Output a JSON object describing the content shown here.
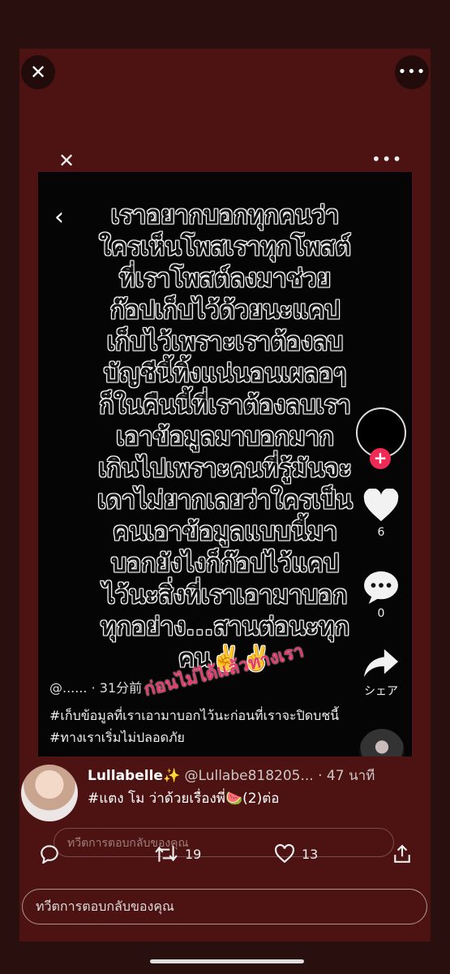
{
  "video": {
    "lines": [
      "เราอยากบอกทุกคนว่า",
      "ใครเห็นโพสเราทุกโพสต์",
      "ที่เราโพสต์ลงมาช่วย",
      "ก๊อปเก็บไว้ด้วยนะแคป",
      "เก็บไว้เพราะเราต้องลบ",
      "บัญชีนี้ทิ้งแน่นอนเผลอๆ",
      "ก็ในคืนนี้ที่เราต้องลบเรา",
      "เอาข้อมูลมาบอกมาก",
      "เกินไปเพราะคนที่รู้มันจะ",
      "เดาไม่ยากเลยว่าใครเป็น",
      "คนเอาข้อมูลแบบนี้มา",
      "บอกยังไงก็ก๊อปไว้แคป",
      "ไว้นะสิ่งที่เราเอามาบอก",
      "ทุกอย่าง...สานต่อนะทุก",
      "คน✌️✌️"
    ],
    "watermark": "ก่อนไม่ได้แล้วทางเรา",
    "handle": "@......",
    "time": "· 31分前",
    "caption": "#เก็บข้อมูลที่เราเอามาบอกไว้นะก่อนที่เราจะปิดบชนี้ #ทางเราเริ่มไม่ปลอดภัย",
    "likes": "6",
    "comments": "0",
    "share_label": "シェア",
    "comment_placeholder": "ทวีตการตอบกลับของคุณ"
  },
  "tweet": {
    "name": "Lullabelle✨",
    "handle": "@Lullabe818205...",
    "time": "· 47 นาที",
    "text": "#แตง โม ว่าด้วยเรื่องพี่🍉(2)ต่อ",
    "retweets": "19",
    "likes": "13",
    "reply_placeholder": "ทวีตการตอบกลับของคุณ"
  },
  "icons": {
    "close": "close-icon",
    "more": "more-icon",
    "reply": "reply-icon",
    "retweet": "retweet-icon",
    "like": "heart-icon",
    "share": "share-icon"
  }
}
